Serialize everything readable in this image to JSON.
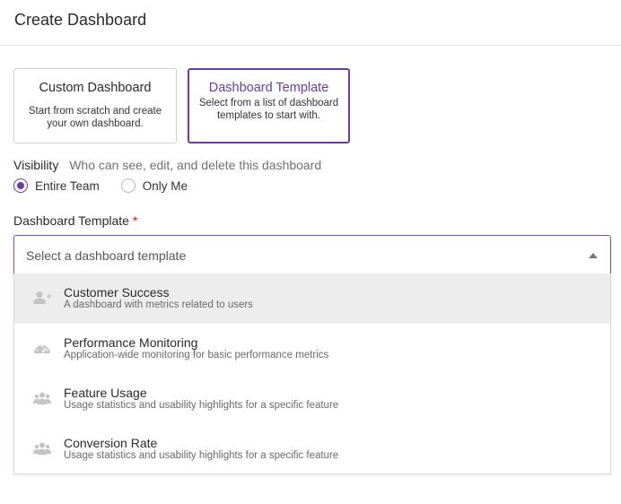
{
  "header": {
    "title": "Create Dashboard"
  },
  "cards": {
    "custom": {
      "title": "Custom Dashboard",
      "desc": "Start from scratch and create your own dashboard."
    },
    "template": {
      "title": "Dashboard Template",
      "desc": "Select from a list of dashboard templates to start with."
    }
  },
  "visibility": {
    "label": "Visibility",
    "help": "Who can see, edit, and delete this dashboard",
    "options": [
      {
        "label": "Entire Team",
        "checked": true
      },
      {
        "label": "Only Me",
        "checked": false
      }
    ]
  },
  "template_field": {
    "label": "Dashboard Template",
    "required_mark": "*",
    "placeholder": "Select a dashboard template"
  },
  "menu": {
    "options": [
      {
        "title": "Customer Success",
        "desc": "A dashboard with metrics related to users",
        "icon": "user-add-icon"
      },
      {
        "title": "Performance Monitoring",
        "desc": "Application-wide monitoring for basic performance metrics",
        "icon": "gauge-icon"
      },
      {
        "title": "Feature Usage",
        "desc": "Usage statistics and usability highlights for a specific feature",
        "icon": "users-icon"
      },
      {
        "title": "Conversion Rate",
        "desc": "Usage statistics and usability highlights for a specific feature",
        "icon": "users-icon"
      }
    ]
  },
  "colors": {
    "accent": "#6d3aa8",
    "required": "#d0021b",
    "hover_bg": "#ededed"
  }
}
